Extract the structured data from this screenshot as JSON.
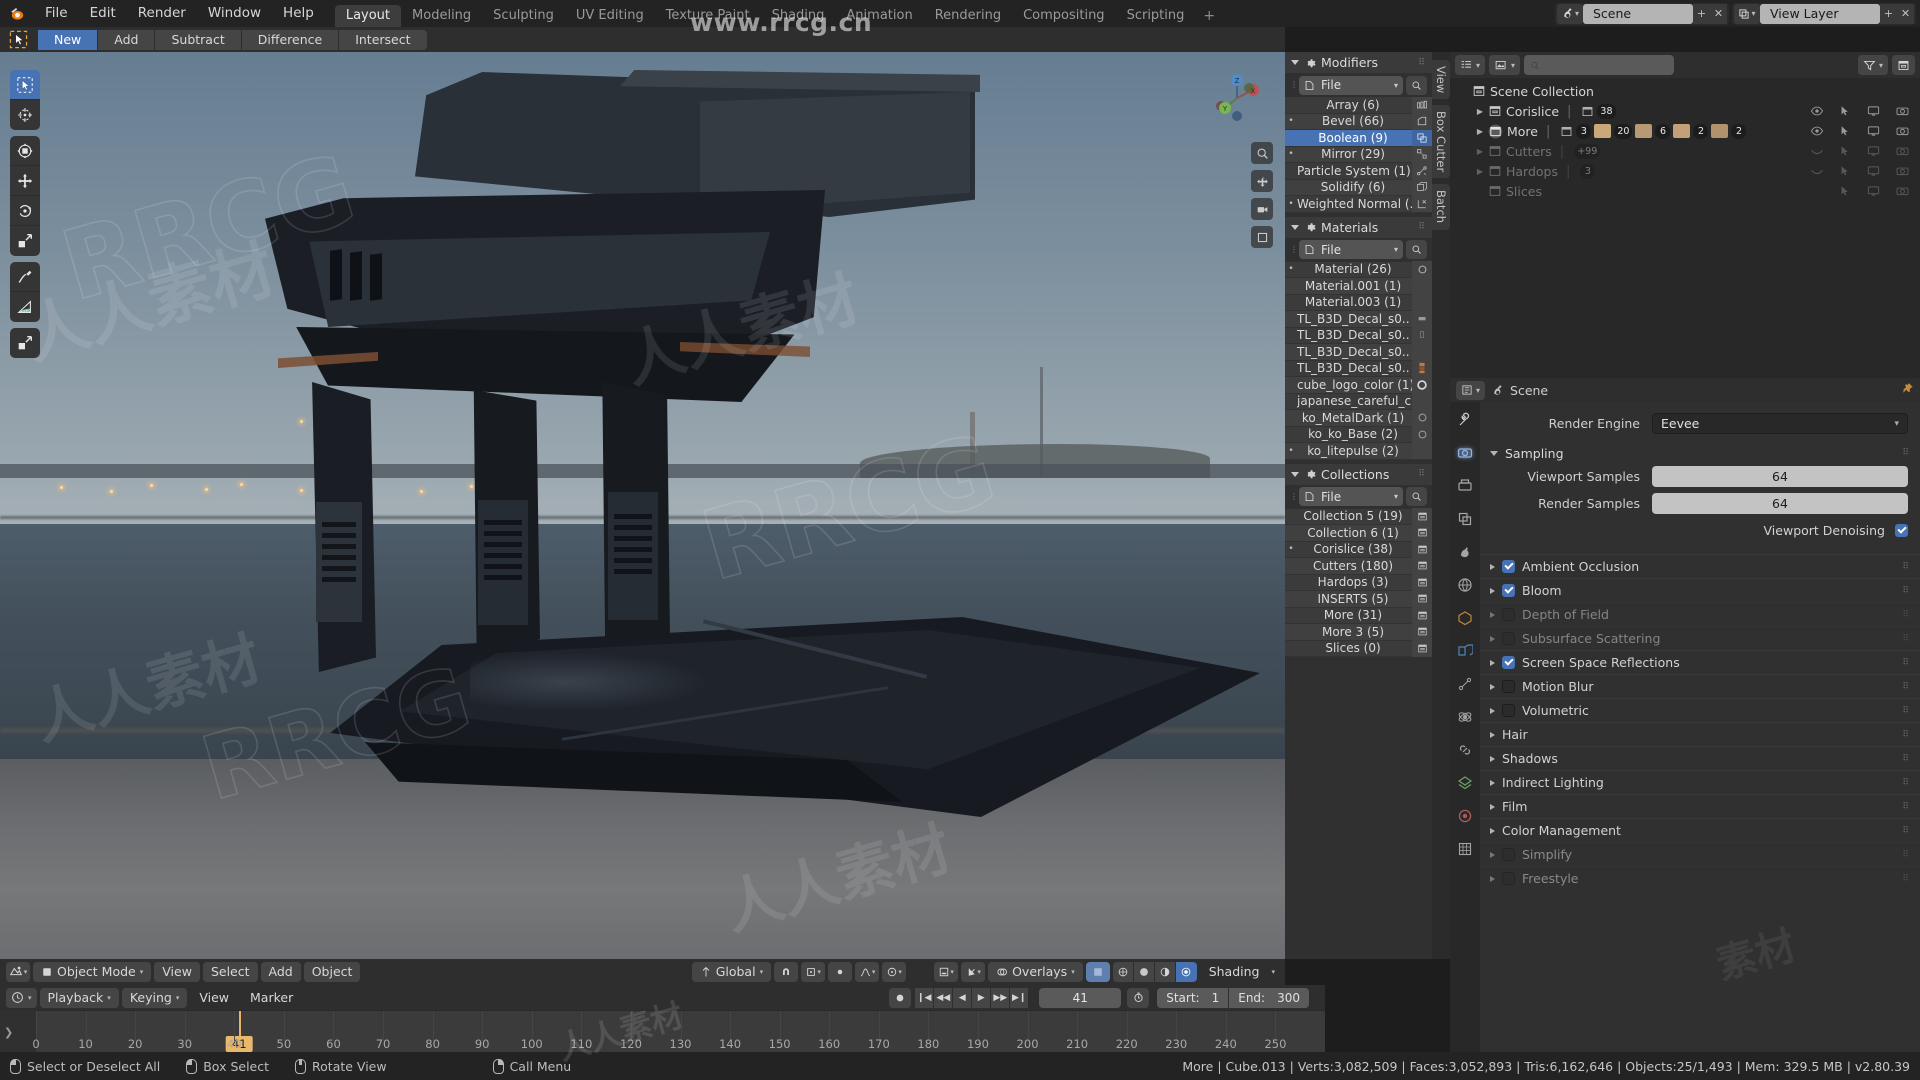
{
  "app": {
    "title": "Blender",
    "version": "v2.80.39"
  },
  "topbar": {
    "menus": [
      "File",
      "Edit",
      "Render",
      "Window",
      "Help"
    ],
    "workspaces": [
      {
        "label": "Layout",
        "active": true
      },
      {
        "label": "Modeling",
        "active": false
      },
      {
        "label": "Sculpting",
        "active": false
      },
      {
        "label": "UV Editing",
        "active": false
      },
      {
        "label": "Texture Paint",
        "active": false
      },
      {
        "label": "Shading",
        "active": false
      },
      {
        "label": "Animation",
        "active": false
      },
      {
        "label": "Rendering",
        "active": false
      },
      {
        "label": "Compositing",
        "active": false
      },
      {
        "label": "Scripting",
        "active": false
      }
    ],
    "add_workspace": "+",
    "scene_name": "Scene",
    "view_layer_name": "View Layer"
  },
  "watermarks": {
    "url": "www.rrcg.cn",
    "brand": "RRCG",
    "cn": "人人素材"
  },
  "boolean_toolbar": {
    "buttons": [
      {
        "label": "New",
        "active": true
      },
      {
        "label": "Add",
        "active": false
      },
      {
        "label": "Subtract",
        "active": false
      },
      {
        "label": "Difference",
        "active": false
      },
      {
        "label": "Intersect",
        "active": false
      }
    ]
  },
  "left_toolbar": {
    "tools": [
      {
        "name": "tweak-select-box",
        "selected": true
      },
      {
        "name": "cursor",
        "selected": false
      },
      {
        "name": "transform-move-rotate",
        "selected": false
      },
      {
        "name": "move",
        "selected": false
      },
      {
        "name": "rotate",
        "selected": false
      },
      {
        "name": "scale",
        "selected": false
      },
      {
        "name": "annotate",
        "selected": false
      },
      {
        "name": "measure",
        "selected": false
      },
      {
        "name": "add-cube",
        "selected": false
      }
    ]
  },
  "viewport_footer": {
    "editor_type": "editor-type-3dview",
    "mode": "Object Mode",
    "menus": [
      "View",
      "Select",
      "Add",
      "Object"
    ],
    "transform_orientation": "Global",
    "overlays_label": "Overlays",
    "shading_label": "Shading"
  },
  "timeline": {
    "editor_icon": "timeline-icon",
    "menus": [
      "Playback",
      "Keying",
      "View",
      "Marker"
    ],
    "current_frame": "41",
    "start_label": "Start:",
    "start_value": "1",
    "end_label": "End:",
    "end_value": "300",
    "ticks": [
      "0",
      "10",
      "20",
      "30",
      "40",
      "50",
      "60",
      "70",
      "80",
      "90",
      "100",
      "110",
      "120",
      "130",
      "140",
      "150",
      "160",
      "170",
      "180",
      "190",
      "200",
      "210",
      "220",
      "230",
      "240",
      "250"
    ],
    "playhead_frame": "41"
  },
  "statusbar": {
    "hints": [
      {
        "mouse": "left",
        "label": "Select or Deselect All"
      },
      {
        "mouse": "middle",
        "label": "Box Select"
      },
      {
        "mouse": "right",
        "label": "Rotate View"
      },
      {
        "mouse": "menu",
        "label": "Call Menu"
      }
    ],
    "stats": "More | Cube.013 | Verts:3,082,509 | Faces:3,052,893 | Tris:6,162,646 | Objects:25/1,493 | Mem: 329.5 MB | v2.80.39"
  },
  "npanel": {
    "vertical_tabs": [
      "View",
      "Box Cutter",
      "Batch"
    ],
    "sections": [
      {
        "title": "Modifiers",
        "file_label": "File",
        "items": [
          {
            "label": "Array (6)",
            "bullet": false,
            "selected": false,
            "icon": "array-icon"
          },
          {
            "label": "Bevel (66)",
            "bullet": true,
            "selected": false,
            "icon": "bevel-icon"
          },
          {
            "label": "Boolean (9)",
            "bullet": false,
            "selected": true,
            "icon": "boolean-icon"
          },
          {
            "label": "Mirror (29)",
            "bullet": true,
            "selected": false,
            "icon": "mirror-icon"
          },
          {
            "label": "Particle System (1)",
            "bullet": false,
            "selected": false,
            "icon": "particles-icon"
          },
          {
            "label": "Solidify (6)",
            "bullet": false,
            "selected": false,
            "icon": "solidify-icon"
          },
          {
            "label": "Weighted Normal (..",
            "bullet": true,
            "selected": false,
            "icon": "weighted-normal-icon"
          }
        ]
      },
      {
        "title": "Materials",
        "file_label": "File",
        "items": [
          {
            "label": "Material (26)",
            "bullet": true,
            "selected": false,
            "icon": "material-sphere-icon"
          },
          {
            "label": "Material.001 (1)",
            "bullet": false,
            "selected": false,
            "icon": ""
          },
          {
            "label": "Material.003 (1)",
            "bullet": false,
            "selected": false,
            "icon": ""
          },
          {
            "label": "TL_B3D_Decal_s0..",
            "bullet": false,
            "selected": false,
            "icon": "decal-icon"
          },
          {
            "label": "TL_B3D_Decal_s0..",
            "bullet": false,
            "selected": false,
            "icon": "decal-icon"
          },
          {
            "label": "TL_B3D_Decal_s0..",
            "bullet": false,
            "selected": false,
            "icon": "decal-icon"
          },
          {
            "label": "TL_B3D_Decal_s0..",
            "bullet": false,
            "selected": false,
            "icon": "decal-color-icon"
          },
          {
            "label": "cube_logo_color (1)",
            "bullet": false,
            "selected": false,
            "icon": "material-sphere-icon"
          },
          {
            "label": "japanese_careful_c..",
            "bullet": false,
            "selected": false,
            "icon": ""
          },
          {
            "label": "ko_MetalDark (1)",
            "bullet": false,
            "selected": false,
            "icon": "material-sphere-icon"
          },
          {
            "label": "ko_ko_Base (2)",
            "bullet": false,
            "selected": false,
            "icon": "material-sphere-icon"
          },
          {
            "label": "ko_litepulse (2)",
            "bullet": true,
            "selected": false,
            "icon": ""
          }
        ]
      },
      {
        "title": "Collections",
        "file_label": "File",
        "items": [
          {
            "label": "Collection 5 (19)",
            "bullet": false,
            "selected": false,
            "icon": "collection-icon"
          },
          {
            "label": "Collection 6 (1)",
            "bullet": false,
            "selected": false,
            "icon": "collection-icon"
          },
          {
            "label": "Corislice (38)",
            "bullet": true,
            "selected": false,
            "icon": "collection-icon"
          },
          {
            "label": "Cutters (180)",
            "bullet": false,
            "selected": false,
            "icon": "collection-icon"
          },
          {
            "label": "Hardops (3)",
            "bullet": false,
            "selected": false,
            "icon": "collection-icon"
          },
          {
            "label": "INSERTS (5)",
            "bullet": false,
            "selected": false,
            "icon": "collection-icon"
          },
          {
            "label": "More (31)",
            "bullet": false,
            "selected": false,
            "icon": "collection-icon"
          },
          {
            "label": "More 3 (5)",
            "bullet": false,
            "selected": false,
            "icon": "collection-icon"
          },
          {
            "label": "Slices (0)",
            "bullet": false,
            "selected": false,
            "icon": "collection-icon"
          }
        ]
      }
    ]
  },
  "outliner": {
    "display_mode": "view-layer-icon",
    "filter_label": "filter-icon",
    "search_placeholder": "",
    "search_value": "",
    "root": "Scene Collection",
    "rows": [
      {
        "label": "Corislice",
        "dim": false,
        "badges": [
          "38"
        ],
        "expandable": true
      },
      {
        "label": "More",
        "dim": false,
        "badges": [
          "3",
          "20",
          "6",
          "2",
          "2"
        ],
        "expandable": true,
        "highlighted": true
      },
      {
        "label": "Cutters",
        "dim": true,
        "badges": [
          "+99"
        ],
        "expandable": true
      },
      {
        "label": "Hardops",
        "dim": true,
        "badges": [
          "3"
        ],
        "expandable": true
      },
      {
        "label": "Slices",
        "dim": true,
        "badges": [],
        "expandable": false
      }
    ]
  },
  "properties": {
    "breadcrumb_scene": "Scene",
    "render_engine_label": "Render Engine",
    "render_engine_value": "Eevee",
    "sampling_label": "Sampling",
    "fields": [
      {
        "label": "Viewport Samples",
        "value": "64"
      },
      {
        "label": "Render Samples",
        "value": "64"
      }
    ],
    "viewport_denoising_label": "Viewport Denoising",
    "viewport_denoising_checked": true,
    "panels": [
      {
        "label": "Ambient Occlusion",
        "checkbox": true,
        "checked": true,
        "dim": false
      },
      {
        "label": "Bloom",
        "checkbox": true,
        "checked": true,
        "dim": false
      },
      {
        "label": "Depth of Field",
        "checkbox": true,
        "checked": false,
        "dim": true
      },
      {
        "label": "Subsurface Scattering",
        "checkbox": true,
        "checked": false,
        "dim": true
      },
      {
        "label": "Screen Space Reflections",
        "checkbox": true,
        "checked": true,
        "dim": false
      },
      {
        "label": "Motion Blur",
        "checkbox": true,
        "checked": false,
        "dim": false
      },
      {
        "label": "Volumetric",
        "checkbox": true,
        "checked": false,
        "dim": false
      },
      {
        "label": "Hair",
        "checkbox": false,
        "checked": false,
        "dim": false
      },
      {
        "label": "Shadows",
        "checkbox": false,
        "checked": false,
        "dim": false
      },
      {
        "label": "Indirect Lighting",
        "checkbox": false,
        "checked": false,
        "dim": false
      },
      {
        "label": "Film",
        "checkbox": false,
        "checked": false,
        "dim": false
      },
      {
        "label": "Color Management",
        "checkbox": false,
        "checked": false,
        "dim": false
      },
      {
        "label": "Simplify",
        "checkbox": true,
        "checked": false,
        "dim": true
      },
      {
        "label": "Freestyle",
        "checkbox": true,
        "checked": false,
        "dim": true
      }
    ]
  },
  "colors": {
    "accent_blue": "#4772b3",
    "panel_bg": "#303030",
    "header_bg": "#2e2e2e",
    "topbar_bg": "#232323",
    "playhead": "#e8b96d",
    "gizmo_orange": "#e8a33d"
  }
}
